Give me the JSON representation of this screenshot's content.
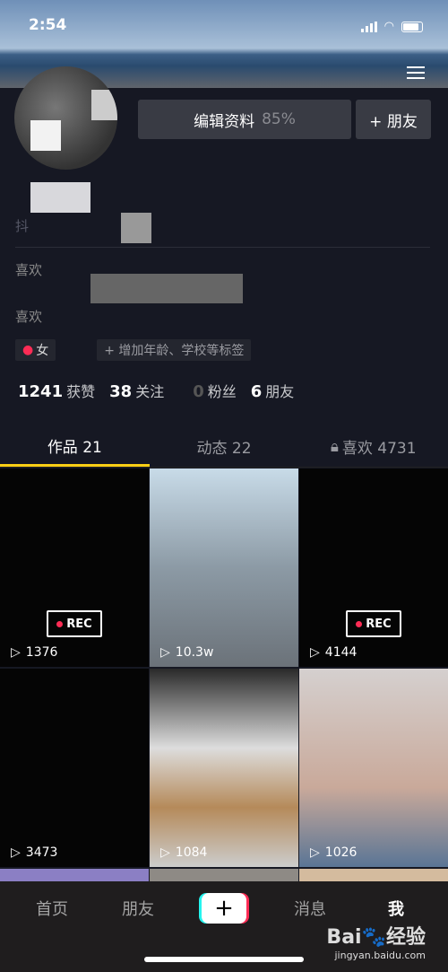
{
  "status_bar": {
    "time": "2:54"
  },
  "profile": {
    "edit_label": "编辑资料",
    "completion": "85%",
    "add_friend_label": "+ 朋友",
    "douyin_id_prefix": "抖",
    "bio_line1": "喜欢",
    "bio_line2": "喜欢",
    "gender_tag": "女",
    "add_tag_label": "+ 增加年龄、学校等标签",
    "stats": [
      {
        "value": "1241",
        "label": "获赞"
      },
      {
        "value": "38",
        "label": "关注"
      },
      {
        "value": "0",
        "label": "粉丝"
      },
      {
        "value": "6",
        "label": "朋友"
      }
    ]
  },
  "tabs": [
    {
      "label": "作品 21",
      "active": true
    },
    {
      "label": "动态 22"
    },
    {
      "label": "喜欢 4731",
      "icon": "lock-icon"
    }
  ],
  "videos": [
    {
      "plays": "1376",
      "rec": true,
      "bg": "#050505"
    },
    {
      "plays": "10.3w",
      "bg": "linear-gradient(180deg,#c8dbe8,#8c9aa5 50%,#6b7279)"
    },
    {
      "plays": "4144",
      "rec": true,
      "bg": "#050505"
    },
    {
      "plays": "3473",
      "bg": "#050505"
    },
    {
      "plays": "1084",
      "bg": "linear-gradient(180deg,#2a2a2a,#ddd 40%,#b58a5a 70%,#ccc)"
    },
    {
      "plays": "1026",
      "bg": "linear-gradient(180deg,#d5d0cf,#c9a99a 60%,#5a7595)"
    },
    {
      "bg": "#8b7fc4"
    },
    {
      "bg": "#8e8a85"
    },
    {
      "bg": "#d4bb9e"
    }
  ],
  "rec_label": "REC",
  "nav": {
    "items": [
      "首页",
      "朋友",
      "消息",
      "我"
    ],
    "plus": "+"
  },
  "watermark": {
    "brand": "Bai du 经验",
    "url": "jingyan.baidu.com"
  },
  "colors": {
    "background": "#161823",
    "accent": "#face15",
    "brand_red": "#fe2c55",
    "brand_cyan": "#25f4ee"
  }
}
